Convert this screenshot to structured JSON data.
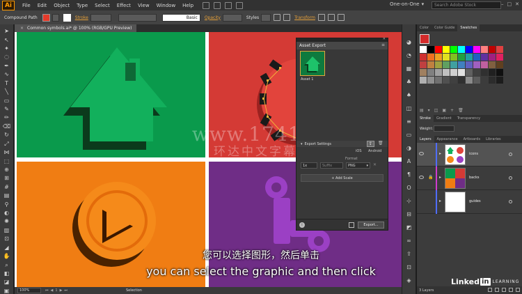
{
  "menubar": {
    "app_logo": "Ai",
    "menus": [
      "File",
      "Edit",
      "Object",
      "Type",
      "Select",
      "Effect",
      "View",
      "Window",
      "Help"
    ],
    "workspace": "One-on-One",
    "search_placeholder": "Search Adobe Stock"
  },
  "controlbar": {
    "selection_type": "Compound Path",
    "stroke_label": "Stroke",
    "stroke_style": "Basic",
    "opacity_label": "Opacity",
    "styles_label": "Styles",
    "transform_label": "Transform"
  },
  "document": {
    "tab_title": "Common symbols.ai* @ 100% (RGB/GPU Preview)",
    "close_glyph": "×"
  },
  "asset_export": {
    "panel_title": "Asset Export",
    "asset_name": "Asset 1",
    "export_settings_label": "Export Settings",
    "ios_label": "iOS",
    "android_label": "Android",
    "format_header": "Format",
    "scale_value": "1x",
    "suffix_placeholder": "Suffix",
    "format_value": "PNG",
    "add_scale_label": "+ Add Scale",
    "export_button": "Export..."
  },
  "statusbar": {
    "zoom": "100%",
    "artboard_number": "1",
    "tool_status": "Selection"
  },
  "right_panels": {
    "color_tabs": [
      "Color",
      "Color Guide",
      "Swatches"
    ],
    "stroke_tabs": [
      "Stroke",
      "Gradient",
      "Transparency"
    ],
    "weight_label": "Weight:",
    "layer_tabs": [
      "Layers",
      "Appearance",
      "Artboards",
      "Libraries"
    ],
    "layers": [
      {
        "name": "icons",
        "color": "#4f6dff",
        "selected": true
      },
      {
        "name": "backs",
        "color": "#d03bd0",
        "selected": false
      },
      {
        "name": "guides",
        "color": "#4f6dff",
        "selected": false
      }
    ],
    "layers_count": "3 Layers",
    "swatch_colors": [
      "#ffffff",
      "#000000",
      "#ff0000",
      "#ffff00",
      "#00ff00",
      "#00ffff",
      "#0000ff",
      "#ff00ff",
      "#ff8080",
      "#c00000",
      "#e04040",
      "#d03030",
      "#f07020",
      "#f0a020",
      "#e0e020",
      "#80c020",
      "#20a040",
      "#20a0a0",
      "#2060c0",
      "#6030a0",
      "#a02080",
      "#e02060",
      "#c04040",
      "#c08040",
      "#a0a040",
      "#60a060",
      "#40a0a0",
      "#4080c0",
      "#6060c0",
      "#a060c0",
      "#c060a0",
      "#806040",
      "#604020",
      "#a08060",
      "#808080",
      "#a0a0a0",
      "#c0c0c0",
      "#d0d0d0",
      "#e0e0e0",
      "#606060",
      "#404040",
      "#303030",
      "#202020",
      "#101010",
      "#b0b0b0",
      "#909090",
      "#707070",
      "#505050",
      "#404040",
      "#303030",
      "#8a8a8a",
      "#5c5c5c",
      "#3c3c3c",
      "#2c2c2c",
      "#1c1c1c"
    ]
  },
  "subtitles": {
    "chinese": "您可以选择图形，然后单击",
    "english": "you can select the graphic and then click"
  },
  "watermark": {
    "url": "www.1741.cn",
    "chinese": "环达中文字幕网"
  },
  "branding": {
    "linkedin_word": "Linked",
    "linkedin_box": "in",
    "learning": "LEARNING"
  }
}
